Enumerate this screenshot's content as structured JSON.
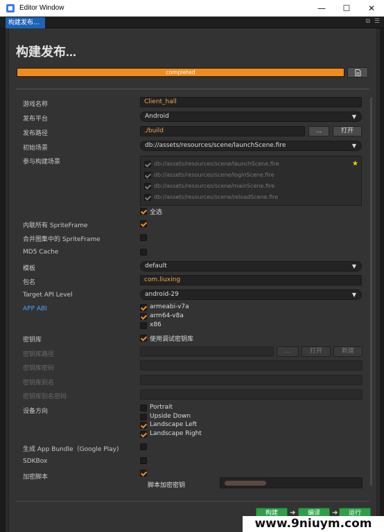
{
  "window": {
    "title": "Editor Window"
  },
  "tab": {
    "label": "构建发布..."
  },
  "heading": "构建发布...",
  "progress": {
    "value": 1.0,
    "label": "completed"
  },
  "fields": {
    "game_name": {
      "label": "游戏名称",
      "value": "Client_hall"
    },
    "platform": {
      "label": "发布平台",
      "value": "Android"
    },
    "build_path": {
      "label": "发布路径",
      "value": "./build",
      "browse_label": "...",
      "open_label": "打开"
    },
    "start_scene": {
      "label": "初始场景",
      "value": "db://assets/resources/scene/launchScene.fire"
    },
    "scenes": {
      "label": "参与构建场景",
      "items": [
        "db://assets/resources/scene/launchScene.fire",
        "db://assets/resources/scene/loginScene.fire",
        "db://assets/resources/scene/mainScene.fire",
        "db://assets/resources/scene/reloadScene.fire"
      ],
      "select_all_label": "全选"
    },
    "inline_spriteframe": {
      "label": "内联所有 SpriteFrame",
      "checked": true
    },
    "merge_spriteframe": {
      "label": "合并图集中的 SpriteFrame",
      "checked": false
    },
    "md5_cache": {
      "label": "MD5 Cache",
      "checked": false
    },
    "template": {
      "label": "模板",
      "value": "default"
    },
    "package_name": {
      "label": "包名",
      "value": "com.liuxing"
    },
    "target_api": {
      "label": "Target API Level",
      "value": "android-29"
    },
    "app_abi": {
      "label": "APP ABI",
      "options": [
        {
          "name": "armeabi-v7a",
          "checked": true
        },
        {
          "name": "arm64-v8a",
          "checked": true
        },
        {
          "name": "x86",
          "checked": false
        }
      ]
    },
    "keystore": {
      "label": "密钥库",
      "option_label": "使用调试密钥库",
      "checked": true
    },
    "keystore_path": {
      "label": "密钥库路径",
      "browse_label": "...",
      "open_label": "打开",
      "new_label": "新建"
    },
    "keystore_password": {
      "label": "密钥库密码"
    },
    "keystore_alias": {
      "label": "密钥库别名"
    },
    "keystore_alias_password": {
      "label": "密钥库别名密码"
    },
    "orientation": {
      "label": "设备方向",
      "options": [
        {
          "name": "Portrait",
          "checked": false
        },
        {
          "name": "Upside Down",
          "checked": false
        },
        {
          "name": "Landscape Left",
          "checked": true
        },
        {
          "name": "Landscape Right",
          "checked": true
        }
      ]
    },
    "app_bundle": {
      "label": "生成 App Bundle（Google Play)",
      "checked": false
    },
    "sdkbox": {
      "label": "SDKBox",
      "checked": false
    },
    "encrypt_script": {
      "label": "加密脚本",
      "checked": true,
      "key_label": "脚本加密密钥"
    }
  },
  "actions": {
    "build": "构建",
    "compile": "编译",
    "run": "运行"
  },
  "watermark": "www.9niuym.com",
  "colors": {
    "accent": "#f08c1c",
    "tab": "#1d63b8",
    "action": "#2f9e4a",
    "abi_label": "#4aa3ff"
  }
}
